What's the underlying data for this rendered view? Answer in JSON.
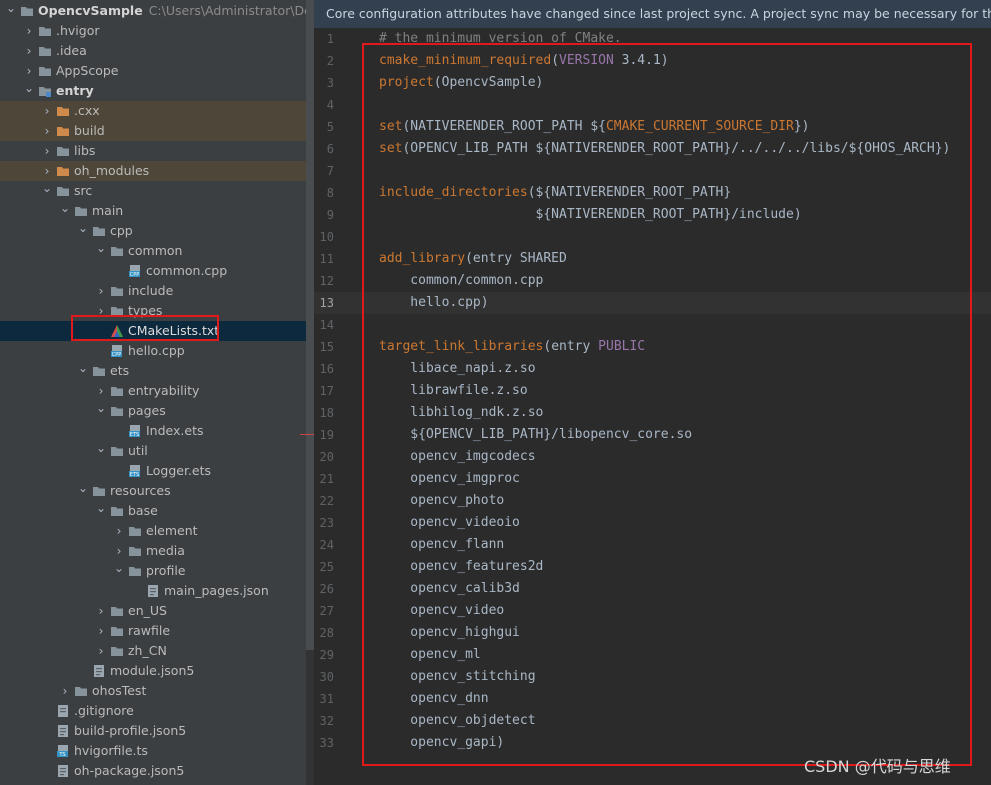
{
  "project_tree": {
    "rows": [
      {
        "label": "OpencvSample",
        "sublabel": "C:\\Users\\Administrator\\DevEco",
        "indent": 0,
        "icon": "folder-icon",
        "expanded": true,
        "bold": true
      },
      {
        "label": ".hvigor",
        "indent": 1,
        "icon": "folder-icon",
        "expanded": false
      },
      {
        "label": ".idea",
        "indent": 1,
        "icon": "folder-icon",
        "expanded": false
      },
      {
        "label": "AppScope",
        "indent": 1,
        "icon": "folder-icon",
        "expanded": false
      },
      {
        "label": "entry",
        "indent": 1,
        "icon": "module-folder-icon",
        "expanded": true,
        "bold": true
      },
      {
        "label": ".cxx",
        "indent": 2,
        "icon": "excluded-folder-icon",
        "expanded": false,
        "dim": true
      },
      {
        "label": "build",
        "indent": 2,
        "icon": "excluded-folder-icon",
        "expanded": false,
        "dim": true
      },
      {
        "label": "libs",
        "indent": 2,
        "icon": "folder-icon",
        "expanded": false
      },
      {
        "label": "oh_modules",
        "indent": 2,
        "icon": "excluded-folder-icon",
        "expanded": false,
        "dim": true
      },
      {
        "label": "src",
        "indent": 2,
        "icon": "folder-icon",
        "expanded": true
      },
      {
        "label": "main",
        "indent": 3,
        "icon": "folder-icon",
        "expanded": true
      },
      {
        "label": "cpp",
        "indent": 4,
        "icon": "folder-icon",
        "expanded": true
      },
      {
        "label": "common",
        "indent": 5,
        "icon": "folder-icon",
        "expanded": true
      },
      {
        "label": "common.cpp",
        "indent": 6,
        "icon": "cpp-file-icon",
        "file": true
      },
      {
        "label": "include",
        "indent": 5,
        "icon": "folder-icon",
        "expanded": false
      },
      {
        "label": "types",
        "indent": 5,
        "icon": "folder-icon",
        "expanded": false
      },
      {
        "label": "CMakeLists.txt",
        "indent": 5,
        "icon": "cmake-file-icon",
        "file": true,
        "selected": true
      },
      {
        "label": "hello.cpp",
        "indent": 5,
        "icon": "cpp-file-icon",
        "file": true
      },
      {
        "label": "ets",
        "indent": 4,
        "icon": "folder-icon",
        "expanded": true
      },
      {
        "label": "entryability",
        "indent": 5,
        "icon": "folder-icon",
        "expanded": false
      },
      {
        "label": "pages",
        "indent": 5,
        "icon": "folder-icon",
        "expanded": true
      },
      {
        "label": "Index.ets",
        "indent": 6,
        "icon": "ets-file-icon",
        "file": true
      },
      {
        "label": "util",
        "indent": 5,
        "icon": "folder-icon",
        "expanded": true
      },
      {
        "label": "Logger.ets",
        "indent": 6,
        "icon": "ets-file-icon",
        "file": true
      },
      {
        "label": "resources",
        "indent": 4,
        "icon": "folder-icon",
        "expanded": true
      },
      {
        "label": "base",
        "indent": 5,
        "icon": "folder-icon",
        "expanded": true
      },
      {
        "label": "element",
        "indent": 6,
        "icon": "folder-icon",
        "expanded": false
      },
      {
        "label": "media",
        "indent": 6,
        "icon": "folder-icon",
        "expanded": false
      },
      {
        "label": "profile",
        "indent": 6,
        "icon": "folder-icon",
        "expanded": true
      },
      {
        "label": "main_pages.json",
        "indent": 7,
        "icon": "json-file-icon",
        "file": true
      },
      {
        "label": "en_US",
        "indent": 5,
        "icon": "folder-icon",
        "expanded": false
      },
      {
        "label": "rawfile",
        "indent": 5,
        "icon": "folder-icon",
        "expanded": false
      },
      {
        "label": "zh_CN",
        "indent": 5,
        "icon": "folder-icon",
        "expanded": false
      },
      {
        "label": "module.json5",
        "indent": 4,
        "icon": "json-file-icon",
        "file": true
      },
      {
        "label": "ohosTest",
        "indent": 3,
        "icon": "folder-icon",
        "expanded": false
      },
      {
        "label": ".gitignore",
        "indent": 2,
        "icon": "text-file-icon",
        "file": true
      },
      {
        "label": "build-profile.json5",
        "indent": 2,
        "icon": "json-file-icon",
        "file": true
      },
      {
        "label": "hvigorfile.ts",
        "indent": 2,
        "icon": "ts-file-icon",
        "file": true
      },
      {
        "label": "oh-package.json5",
        "indent": 2,
        "icon": "json-file-icon",
        "file": true
      }
    ]
  },
  "editor": {
    "banner": "Core configuration attributes have changed since last project sync. A project sync may be necessary for the IDE to",
    "current_line": 13,
    "lines": [
      [
        {
          "t": "# the minimum version of CMake.",
          "c": "cm"
        }
      ],
      [
        {
          "t": "cmake_minimum_required",
          "c": "kw"
        },
        {
          "t": "("
        },
        {
          "t": "VERSION",
          "c": "var"
        },
        {
          "t": " 3.4.1)"
        }
      ],
      [
        {
          "t": "project",
          "c": "kw"
        },
        {
          "t": "(OpencvSample)"
        }
      ],
      [],
      [
        {
          "t": "set",
          "c": "kw"
        },
        {
          "t": "(NATIVERENDER_ROOT_PATH ${"
        },
        {
          "t": "CMAKE_CURRENT_SOURCE_DIR",
          "c": "kw"
        },
        {
          "t": "})"
        }
      ],
      [
        {
          "t": "set",
          "c": "kw"
        },
        {
          "t": "(OPENCV_LIB_PATH ${NATIVERENDER_ROOT_PATH}/../../../libs/${OHOS_ARCH})"
        }
      ],
      [],
      [
        {
          "t": "include_directories",
          "c": "kw"
        },
        {
          "t": "(${NATIVERENDER_ROOT_PATH}"
        }
      ],
      [
        {
          "t": "                    ${NATIVERENDER_ROOT_PATH}/include)"
        }
      ],
      [],
      [
        {
          "t": "add_library",
          "c": "kw"
        },
        {
          "t": "(entry SHARED"
        }
      ],
      [
        {
          "t": "    common/common.cpp"
        }
      ],
      [
        {
          "t": "    hello.cpp)"
        }
      ],
      [],
      [
        {
          "t": "target_link_libraries",
          "c": "kw"
        },
        {
          "t": "(entry "
        },
        {
          "t": "PUBLIC",
          "c": "var"
        }
      ],
      [
        {
          "t": "    libace_napi.z.so"
        }
      ],
      [
        {
          "t": "    librawfile.z.so"
        }
      ],
      [
        {
          "t": "    libhilog_ndk.z.so"
        }
      ],
      [
        {
          "t": "    ${OPENCV_LIB_PATH}/libopencv_core.so"
        }
      ],
      [
        {
          "t": "    opencv_imgcodecs"
        }
      ],
      [
        {
          "t": "    opencv_imgproc"
        }
      ],
      [
        {
          "t": "    opencv_photo"
        }
      ],
      [
        {
          "t": "    opencv_videoio"
        }
      ],
      [
        {
          "t": "    opencv_flann"
        }
      ],
      [
        {
          "t": "    opencv_features2d"
        }
      ],
      [
        {
          "t": "    opencv_calib3d"
        }
      ],
      [
        {
          "t": "    opencv_video"
        }
      ],
      [
        {
          "t": "    opencv_highgui"
        }
      ],
      [
        {
          "t": "    opencv_ml"
        }
      ],
      [
        {
          "t": "    opencv_stitching"
        }
      ],
      [
        {
          "t": "    opencv_dnn"
        }
      ],
      [
        {
          "t": "    opencv_objdetect"
        }
      ],
      [
        {
          "t": "    opencv_gapi)"
        }
      ]
    ]
  },
  "watermark": "CSDN @代码与思维",
  "colors": {
    "keyword": "#cc7832",
    "constant": "#9876aa",
    "comment": "#808080",
    "text": "#a9b7c6",
    "highlight_box": "#e0191a"
  }
}
